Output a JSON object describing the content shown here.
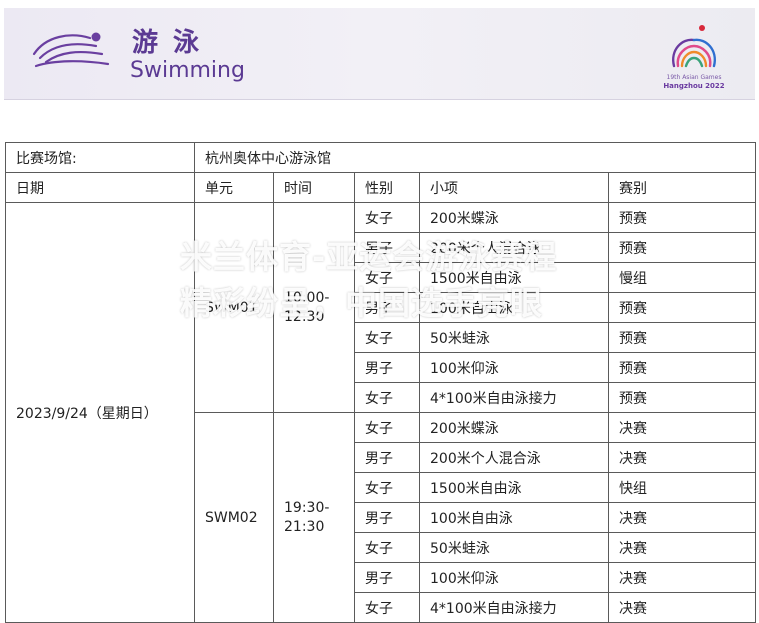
{
  "banner": {
    "title_cn": "游 泳",
    "title_en": "Swimming",
    "games_line1": "19th Asian Games",
    "games_line2": "Hangzhou 2022",
    "brand_color": "#5b3a93"
  },
  "venue": {
    "label": "比赛场馆:",
    "name": "杭州奥体中心游泳馆"
  },
  "headers": {
    "date": "日期",
    "unit": "单元",
    "time": "时间",
    "gender": "性别",
    "event": "小项",
    "round": "赛别"
  },
  "date": "2023/9/24（星期日）",
  "sessions": [
    {
      "unit": "SWM01",
      "time": "10:00-\n12:30",
      "rows": [
        {
          "gender": "女子",
          "event": "200米蝶泳",
          "round": "预赛"
        },
        {
          "gender": "男子",
          "event": "200米个人混合泳",
          "round": "预赛"
        },
        {
          "gender": "女子",
          "event": "1500米自由泳",
          "round": "慢组"
        },
        {
          "gender": "男子",
          "event": "100米自由泳",
          "round": "预赛"
        },
        {
          "gender": "女子",
          "event": "50米蛙泳",
          "round": "预赛"
        },
        {
          "gender": "男子",
          "event": "100米仰泳",
          "round": "预赛"
        },
        {
          "gender": "女子",
          "event": "4*100米自由泳接力",
          "round": "预赛"
        }
      ]
    },
    {
      "unit": "SWM02",
      "time": "19:30-\n21:30",
      "rows": [
        {
          "gender": "女子",
          "event": "200米蝶泳",
          "round": "决赛"
        },
        {
          "gender": "男子",
          "event": "200米个人混合泳",
          "round": "决赛"
        },
        {
          "gender": "女子",
          "event": "1500米自由泳",
          "round": "快组"
        },
        {
          "gender": "男子",
          "event": "100米自由泳",
          "round": "决赛"
        },
        {
          "gender": "女子",
          "event": "50米蛙泳",
          "round": "决赛"
        },
        {
          "gender": "男子",
          "event": "100米仰泳",
          "round": "决赛"
        },
        {
          "gender": "女子",
          "event": "4*100米自由泳接力",
          "round": "决赛"
        }
      ]
    }
  ],
  "watermark": {
    "line1": "米兰体育-亚运会游泳赛程",
    "line2": "精彩纷呈，中国选手亮眼"
  }
}
